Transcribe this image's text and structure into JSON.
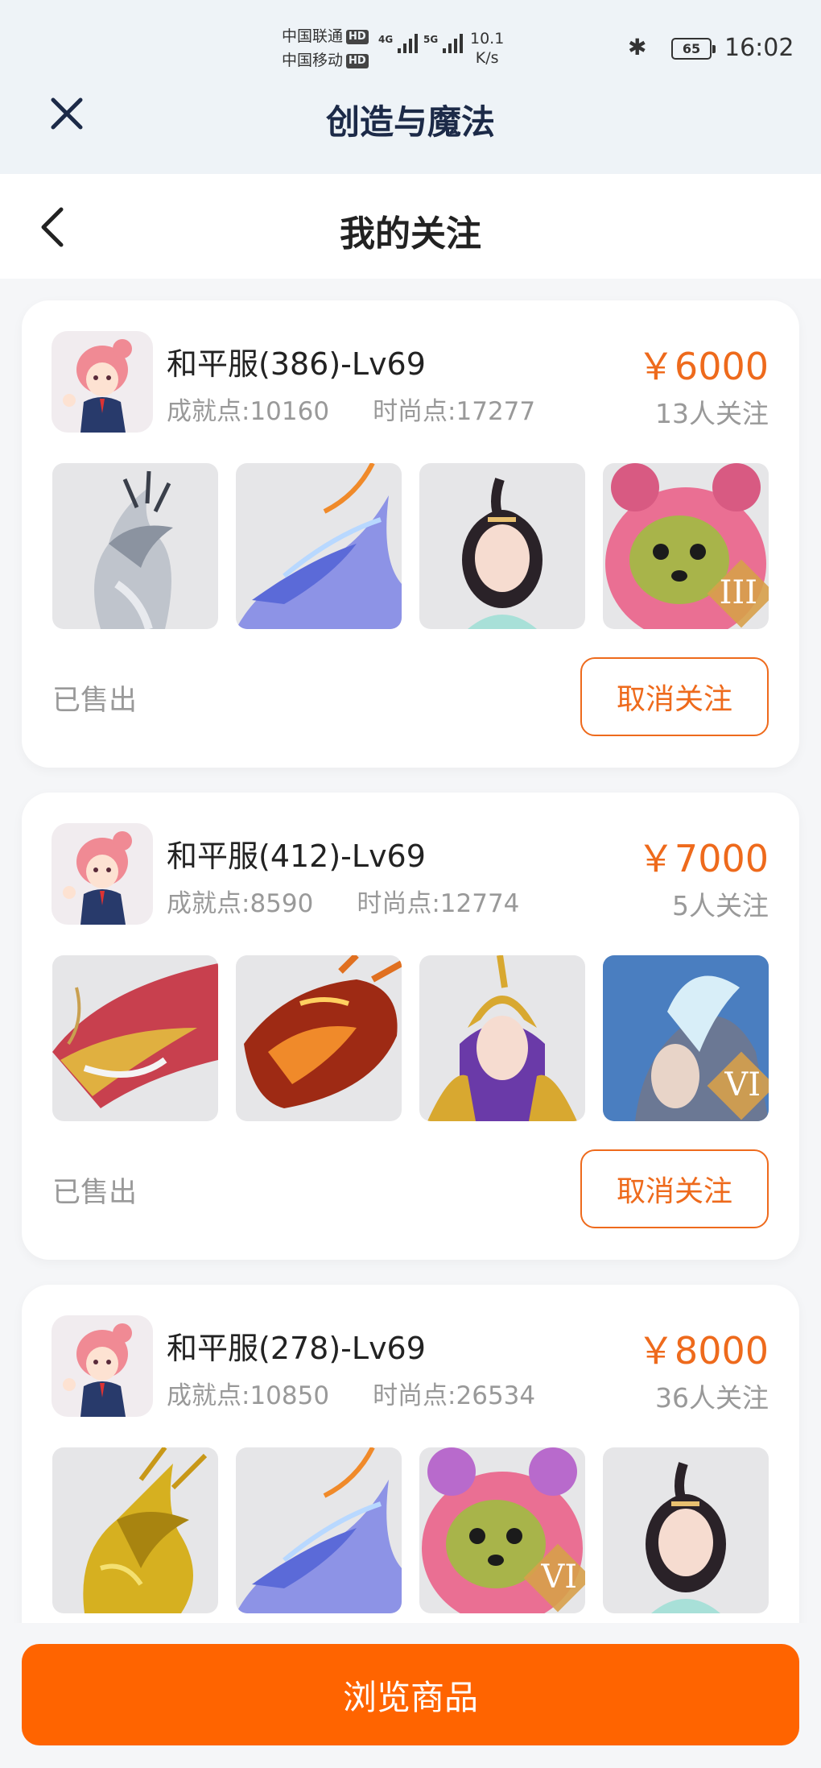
{
  "status_bar": {
    "carrier1": "中国联通",
    "carrier2": "中国移动",
    "hd": "HD",
    "net1": "4G",
    "net2": "5G",
    "speed_value": "10.1",
    "speed_unit": "K/s",
    "battery": "65",
    "time": "16:02"
  },
  "app_bar": {
    "title": "创造与魔法"
  },
  "nav_bar": {
    "title": "我的关注"
  },
  "colors": {
    "accent": "#ee6a1c",
    "button": "#ff6400"
  },
  "listings": [
    {
      "server": "和平服(386)-Lv69",
      "achievement": "成就点:10160",
      "fashion": "时尚点:17277",
      "price": "￥6000",
      "followers": "13人关注",
      "status": "已售出",
      "action": "取消关注",
      "items": [
        {
          "name": "silver-dragon-mount",
          "badge": ""
        },
        {
          "name": "blue-dragon-mount",
          "badge": ""
        },
        {
          "name": "maiden-costume",
          "badge": ""
        },
        {
          "name": "pink-bear-costume",
          "badge": "III"
        }
      ]
    },
    {
      "server": "和平服(412)-Lv69",
      "achievement": "成就点:8590",
      "fashion": "时尚点:12774",
      "price": "￥7000",
      "followers": "5人关注",
      "status": "已售出",
      "action": "取消关注",
      "items": [
        {
          "name": "red-gold-dragon-mount",
          "badge": ""
        },
        {
          "name": "fire-dragon-mount",
          "badge": ""
        },
        {
          "name": "pharaoh-costume",
          "badge": ""
        },
        {
          "name": "ice-knight-costume",
          "badge": "VI"
        }
      ]
    },
    {
      "server": "和平服(278)-Lv69",
      "achievement": "成就点:10850",
      "fashion": "时尚点:26534",
      "price": "￥8000",
      "followers": "36人关注",
      "status": "",
      "action": "",
      "items": [
        {
          "name": "golden-dragon-mount",
          "badge": ""
        },
        {
          "name": "blue-dragon-mount",
          "badge": ""
        },
        {
          "name": "pink-bear-costume",
          "badge": "VI"
        },
        {
          "name": "maiden-costume",
          "badge": ""
        }
      ]
    }
  ],
  "footer": {
    "browse_label": "浏览商品"
  }
}
